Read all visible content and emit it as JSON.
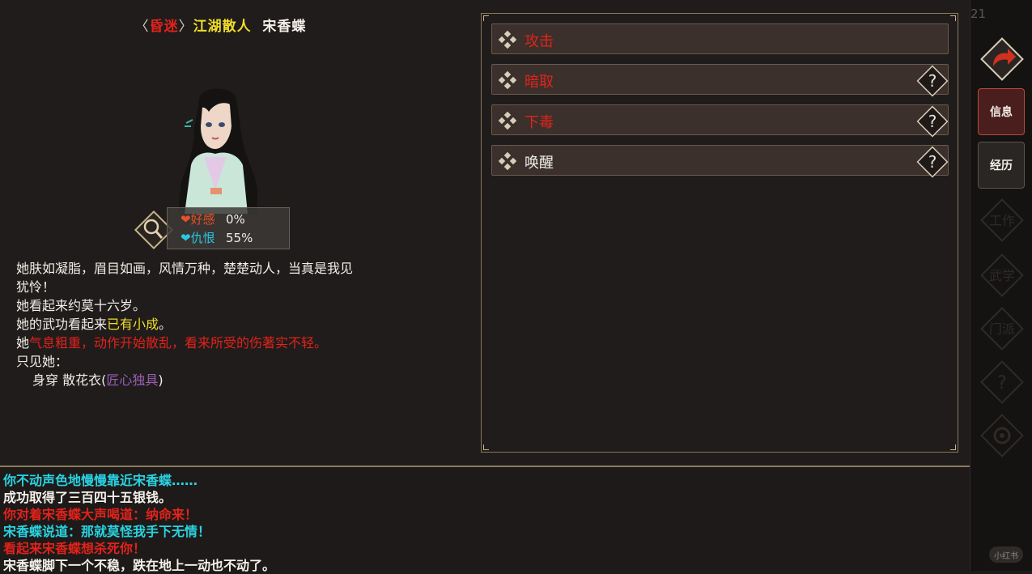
{
  "header": {
    "bracket_open": "〈",
    "status": "昏迷",
    "bracket_close": "〉",
    "faction": "江湖散人",
    "name": "宋香蝶"
  },
  "stats": {
    "favor": {
      "label": "好感",
      "value": "0%",
      "icon": "heart-icon",
      "color": "#e8502a"
    },
    "hatred": {
      "label": "仇恨",
      "value": "55%",
      "icon": "heart-icon",
      "color": "#29c8e0"
    }
  },
  "description": {
    "line1": "她肤如凝脂，眉目如画，风情万种，楚楚动人，当真是我见",
    "line2": "犹怜！",
    "line3": "她看起来约莫十六岁。",
    "line4_prefix": "她的武功看起来",
    "line4_level": "已有小成",
    "line4_suffix": "。",
    "line5_prefix": "她",
    "line5_state": "气息粗重，动作开始散乱，看来所受的伤著实不轻。",
    "line6": "只见她：",
    "line7_prefix": "身穿  散花衣(",
    "line7_quality": "匠心独具",
    "line7_suffix": ")"
  },
  "actions": [
    {
      "label": "攻击",
      "color": "#e2221b",
      "has_help": false
    },
    {
      "label": "暗取",
      "color": "#e2221b",
      "has_help": true,
      "help_icon": "question-icon"
    },
    {
      "label": "下毒",
      "color": "#e2221b",
      "has_help": true,
      "help_icon": "question-icon"
    },
    {
      "label": "唤醒",
      "color": "#f2eee8",
      "has_help": true,
      "help_icon": "question-icon"
    }
  ],
  "log": [
    {
      "text": "你不动声色地慢慢靠近宋香蝶……",
      "color": "cyan"
    },
    {
      "text": "成功取得了三百四十五银钱。",
      "color": "white"
    },
    {
      "text": "你对着宋香蝶大声喝道：纳命来！",
      "color": "red"
    },
    {
      "text": "宋香蝶说道：那就莫怪我手下无情！",
      "color": "cyan"
    },
    {
      "text": "看起来宋香蝶想杀死你！",
      "color": "red"
    },
    {
      "text": "宋香蝶脚下一个不稳，跌在地上一动也不动了。",
      "color": "white"
    }
  ],
  "sidebar": {
    "top_number": "21",
    "back_icon": "back-arrow-icon",
    "tabs": [
      {
        "label": "信息",
        "active": true
      },
      {
        "label": "经历",
        "active": false
      }
    ],
    "faint_tabs": [
      {
        "label": "工作"
      },
      {
        "label": "武学"
      },
      {
        "label": "门派"
      },
      {
        "label": "?",
        "icon": "question-icon"
      },
      {
        "label": "",
        "icon": "gear-icon"
      }
    ]
  },
  "watermark": "小红书"
}
